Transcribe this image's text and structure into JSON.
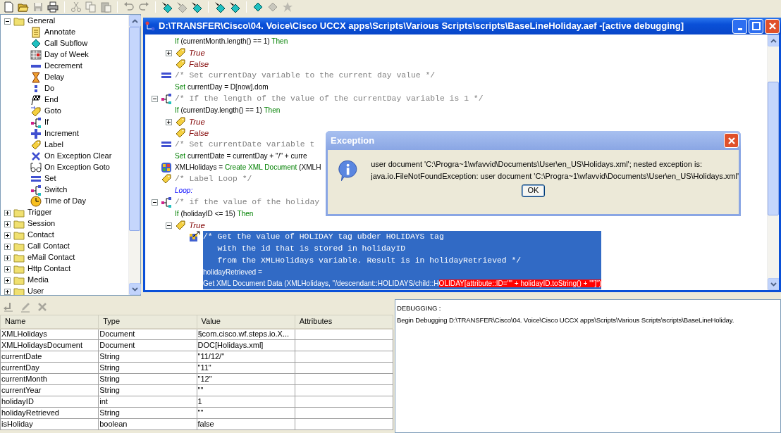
{
  "toolbar": [
    {
      "kind": "page",
      "disabled": false
    },
    {
      "kind": "open-folder",
      "disabled": false
    },
    {
      "kind": "save",
      "disabled": true
    },
    {
      "kind": "printer",
      "disabled": false
    },
    {
      "kind": "separator"
    },
    {
      "kind": "scissors",
      "disabled": true
    },
    {
      "kind": "copy",
      "disabled": true
    },
    {
      "kind": "clipboard",
      "disabled": true
    },
    {
      "kind": "separator"
    },
    {
      "kind": "undo",
      "disabled": true
    },
    {
      "kind": "redo",
      "disabled": true
    },
    {
      "kind": "separator"
    },
    {
      "kind": "diamond-arrow",
      "disabled": false
    },
    {
      "kind": "diamond-arrow",
      "disabled": true
    },
    {
      "kind": "diamond-arrow",
      "disabled": false
    },
    {
      "kind": "separator"
    },
    {
      "kind": "diamond-arrow",
      "disabled": false
    },
    {
      "kind": "diamond-arrow",
      "disabled": false
    },
    {
      "kind": "separator"
    },
    {
      "kind": "diamond",
      "disabled": false
    },
    {
      "kind": "diamond",
      "disabled": true
    },
    {
      "kind": "star",
      "disabled": true
    }
  ],
  "palette": [
    {
      "label": "General",
      "expanded": true,
      "children": [
        {
          "label": "Annotate",
          "kind": "note"
        },
        {
          "label": "Call Subflow",
          "kind": "diamond"
        },
        {
          "label": "Day of Week",
          "kind": "calendar"
        },
        {
          "label": "Decrement",
          "kind": "minus"
        },
        {
          "label": "Delay",
          "kind": "hourglass"
        },
        {
          "label": "Do",
          "kind": "dots"
        },
        {
          "label": "End",
          "kind": "flag"
        },
        {
          "label": "Goto",
          "kind": "tag-arrow"
        },
        {
          "label": "If",
          "kind": "branch"
        },
        {
          "label": "Increment",
          "kind": "plus"
        },
        {
          "label": "Label",
          "kind": "tag"
        },
        {
          "label": "On Exception Clear",
          "kind": "cross"
        },
        {
          "label": "On Exception Goto",
          "kind": "glasses"
        },
        {
          "label": "Set",
          "kind": "equals"
        },
        {
          "label": "Switch",
          "kind": "branch"
        },
        {
          "label": "Time of Day",
          "kind": "clock"
        }
      ]
    },
    {
      "label": "Trigger",
      "expanded": false
    },
    {
      "label": "Session",
      "expanded": false
    },
    {
      "label": "Contact",
      "expanded": false
    },
    {
      "label": "Call Contact",
      "expanded": false
    },
    {
      "label": "eMail Contact",
      "expanded": false
    },
    {
      "label": "Http Contact",
      "expanded": false
    },
    {
      "label": "Media",
      "expanded": false
    },
    {
      "label": "User",
      "expanded": false
    }
  ],
  "editor": {
    "title": "D:\\TRANSFER\\Cisco\\04. Voice\\Cisco UCCX apps\\Scripts\\Various Scripts\\scripts\\BaseLineHoliday.aef -[active debugging]",
    "script": [
      {
        "kind": "if-continued",
        "selected": false,
        "statement": [
          [
            {
              "text": "If",
              "kind": "keyword"
            },
            {
              "text": " (currentMonth.length() == 1) ",
              "kind": "plain"
            },
            {
              "text": "Then",
              "kind": "keyword"
            }
          ]
        ],
        "children": [
          {
            "kind": "branch",
            "label": "True",
            "expanded": false,
            "selected": false
          },
          {
            "kind": "branch",
            "label": "False",
            "selected": false
          }
        ]
      },
      {
        "kind": "set",
        "selected": false,
        "comment": "/* Set currentDay variable to the current day value */",
        "statement": [
          [
            {
              "text": "Set",
              "kind": "keyword"
            },
            {
              "text": " currentDay = D[now].dom",
              "kind": "plain"
            }
          ]
        ]
      },
      {
        "kind": "if",
        "expanded": true,
        "selected": false,
        "comment": "/* If the length of the value of the currentDay variable is 1 */",
        "statement": [
          [
            {
              "text": "If",
              "kind": "keyword"
            },
            {
              "text": " (currentDay.length() == 1) ",
              "kind": "plain"
            },
            {
              "text": "Then",
              "kind": "keyword"
            }
          ]
        ],
        "children": [
          {
            "kind": "branch",
            "label": "True",
            "expanded": false,
            "selected": false
          },
          {
            "kind": "branch",
            "label": "False",
            "selected": false
          }
        ]
      },
      {
        "kind": "set",
        "selected": false,
        "comment": "/* Set currentDate variable t",
        "statement": [
          [
            {
              "text": "Set",
              "kind": "keyword"
            },
            {
              "text": " currentDate = currentDay + \"/\" + curre",
              "kind": "plain"
            }
          ]
        ]
      },
      {
        "kind": "create-xml",
        "selected": false,
        "statement": [
          [
            {
              "text": "XMLHolidays = ",
              "kind": "plain"
            },
            {
              "text": "Create XML Document",
              "kind": "keyword"
            },
            {
              "text": " (XMLH",
              "kind": "plain"
            }
          ]
        ]
      },
      {
        "kind": "label",
        "selected": false,
        "comment": "/* Label Loop */",
        "statement": [
          [
            {
              "text": "Loop:",
              "kind": "label"
            }
          ]
        ]
      },
      {
        "kind": "if",
        "expanded": true,
        "selected": false,
        "comment": "/* if the value of the holiday",
        "statement": [
          [
            {
              "text": "If",
              "kind": "keyword"
            },
            {
              "text": " (holidayID <= 15) ",
              "kind": "plain"
            },
            {
              "text": "Then",
              "kind": "keyword"
            }
          ]
        ],
        "children": [
          {
            "kind": "branch",
            "label": "True",
            "expanded": true,
            "selected": false,
            "children": [
              {
                "kind": "get-xml",
                "selected": true,
                "comment": "/* Get the value of HOLIDAY tag ubder HOLIDAYS tag\n   with the id that is stored in holidayID\n   from the XMLHolidays variable. Result is in holidayRetrieved */",
                "statement": [
                  [
                    {
                      "text": "holidayRetrieved =",
                      "kind": "plain"
                    }
                  ],
                  [
                    {
                      "text": "Get XML Document Data (XMLHolidays, \"/descendant::HOLIDAYS/child::H",
                      "kind": "plain"
                    },
                    {
                      "text": "OLIDAY[attribute::ID=\"\" + holidayID.toString() + \"\"]\")",
                      "kind": "error"
                    }
                  ]
                ]
              }
            ]
          }
        ]
      }
    ]
  },
  "dialog": {
    "title": "Exception",
    "message": [
      "user document 'C:\\Progra~1\\wfavvid\\Documents\\User\\en_US\\Holidays.xml'; nested exception is:",
      "java.io.FileNotFoundException: user document 'C:\\Progra~1\\wfavvid\\Documents\\User\\en_US\\Holidays.xml'"
    ],
    "buttons": [
      "OK"
    ]
  },
  "variables": {
    "toolbar": [
      {
        "kind": "back-arrow",
        "disabled": true
      },
      {
        "kind": "pencil",
        "disabled": true
      },
      {
        "kind": "cross",
        "disabled": true
      }
    ],
    "columns": [
      "Name",
      "Type",
      "Value",
      "Attributes"
    ],
    "rows": [
      [
        "XMLHolidays",
        "Document",
        "§com.cisco.wf.steps.io.X..."
      ],
      [
        "XMLHolidaysDocument",
        "Document",
        "DOC[Holidays.xml]"
      ],
      [
        "currentDate",
        "String",
        "\"11/12/\""
      ],
      [
        "currentDay",
        "String",
        "\"11\""
      ],
      [
        "currentMonth",
        "String",
        "\"12\""
      ],
      [
        "currentYear",
        "String",
        "\"\""
      ],
      [
        "holidayID",
        "int",
        "1"
      ],
      [
        "holidayRetrieved",
        "String",
        "\"\""
      ],
      [
        "isHoliday",
        "boolean",
        "false"
      ]
    ]
  },
  "debug_output": [
    "DEBUGGING :",
    "Begin Debugging D:\\TRANSFER\\Cisco\\04. Voice\\Cisco UCCX apps\\Scripts\\Various Scripts\\scripts\\BaseLineHoliday."
  ]
}
